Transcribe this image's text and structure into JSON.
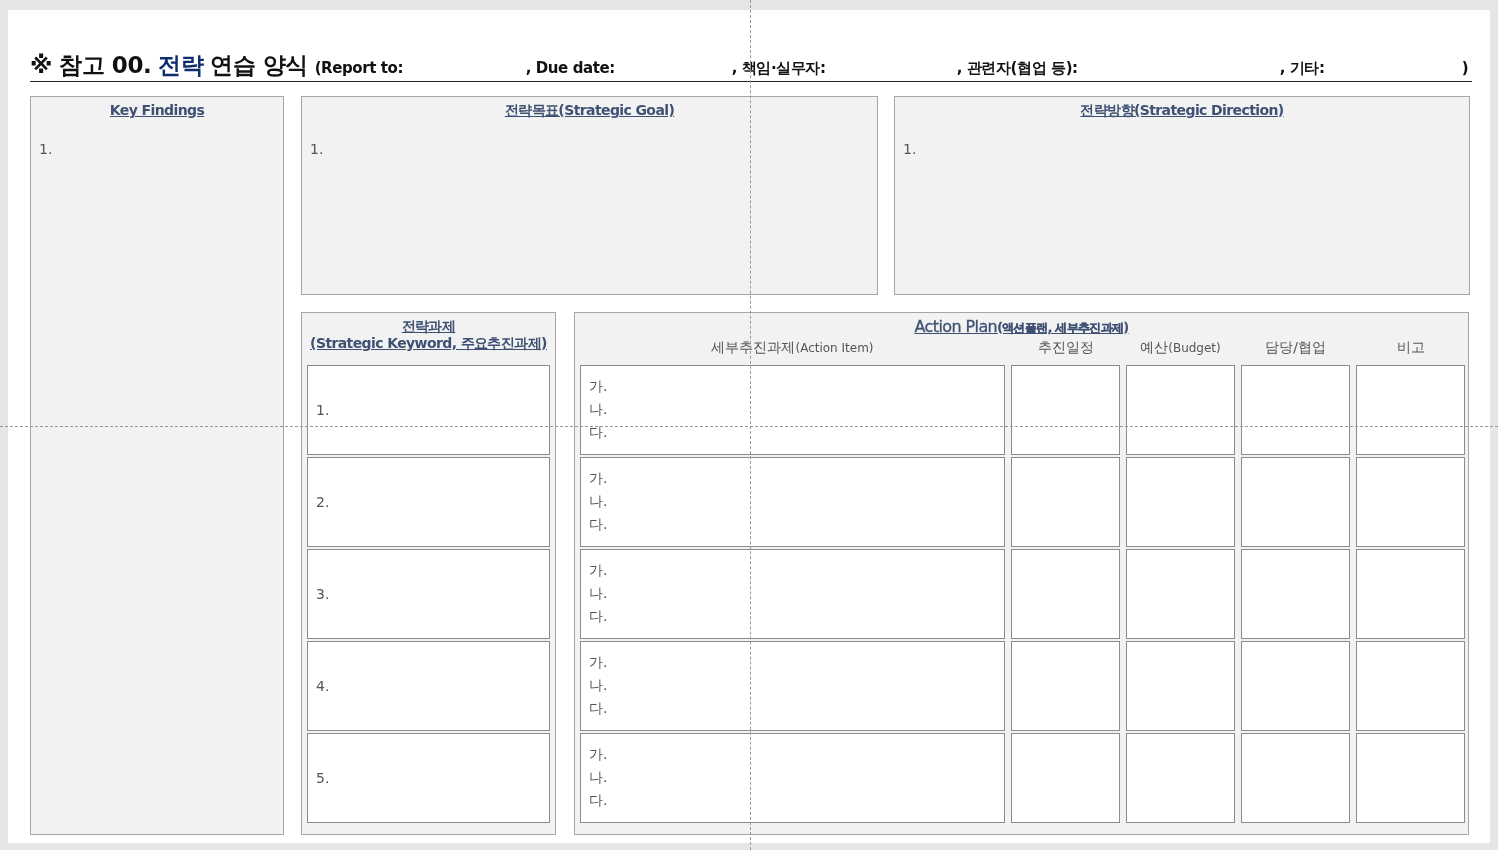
{
  "header": {
    "title_parts": [
      {
        "text": "※ 참고 00.",
        "highlight": false
      },
      {
        "text": "전략",
        "highlight": true
      },
      {
        "text": "연습 양식",
        "highlight": false
      }
    ],
    "fields": [
      "(Report to:",
      ", Due date:",
      ", 책임·실무자:",
      ", 관련자(협업 등):",
      ", 기타:",
      ")"
    ]
  },
  "key_findings": {
    "heading": "Key Findings",
    "items": [
      "1."
    ]
  },
  "strategic_goal": {
    "heading": "전략목표(Strategic Goal)",
    "items": [
      "1."
    ]
  },
  "strategic_direction": {
    "heading": "전략방향(Strategic Direction)",
    "items": [
      "1."
    ]
  },
  "strategic_tasks": {
    "heading_lines": [
      "전략과제",
      "(Strategic Keyword, 주요추진과제)"
    ],
    "rows": [
      "1.",
      "2.",
      "3.",
      "4.",
      "5."
    ]
  },
  "action_plan": {
    "heading": {
      "main": "Action Plan",
      "sub": "(액션플랜, 세부추진과제)"
    },
    "columns": [
      {
        "main": "세부추진과제",
        "sub": "(Action Item)"
      },
      {
        "main": "추진일정"
      },
      {
        "main": "예산",
        "sub": "(Budget)"
      },
      {
        "main": "담당/협업"
      },
      {
        "main": "비고"
      }
    ],
    "rows": [
      {
        "items": [
          "가.",
          "나.",
          "다."
        ]
      },
      {
        "items": [
          "가.",
          "나.",
          "다."
        ]
      },
      {
        "items": [
          "가.",
          "나.",
          "다."
        ]
      },
      {
        "items": [
          "가.",
          "나.",
          "다."
        ]
      },
      {
        "items": [
          "가.",
          "나.",
          "다."
        ]
      }
    ]
  }
}
